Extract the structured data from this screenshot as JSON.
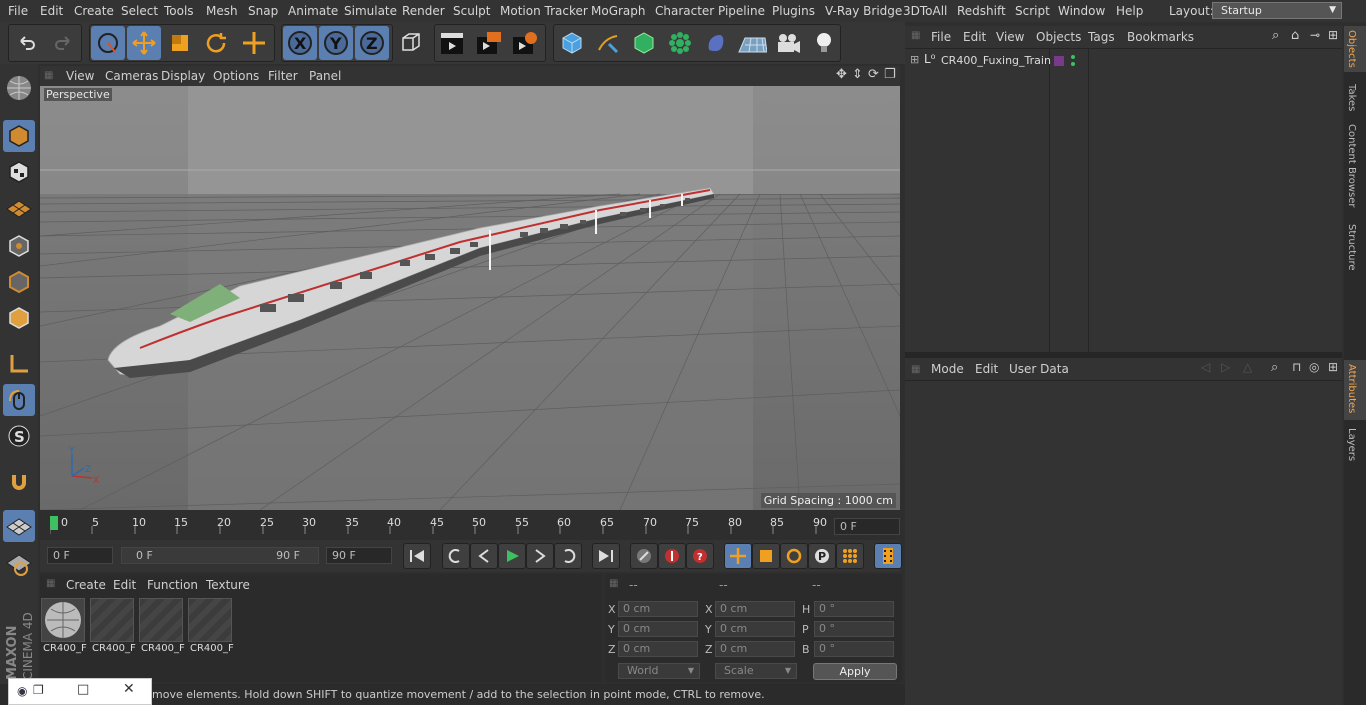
{
  "menubar": {
    "items": [
      "File",
      "Edit",
      "Create",
      "Select",
      "Tools",
      "Mesh",
      "Snap",
      "Animate",
      "Simulate",
      "Render",
      "Sculpt",
      "Motion Tracker",
      "MoGraph",
      "Character",
      "Pipeline",
      "Plugins",
      "V-Ray Bridge",
      "3DToAll",
      "Redshift",
      "Script",
      "Window",
      "Help"
    ],
    "layout_label": "Layout:",
    "layout_value": "Startup"
  },
  "viewport": {
    "menu": [
      "View",
      "Cameras",
      "Display",
      "Options",
      "Filter",
      "Panel"
    ],
    "camera_label": "Perspective",
    "grid_spacing": "Grid Spacing : 1000 cm"
  },
  "timeline": {
    "ticks": [
      "0",
      "5",
      "10",
      "15",
      "20",
      "25",
      "30",
      "35",
      "40",
      "45",
      "50",
      "55",
      "60",
      "65",
      "70",
      "75",
      "80",
      "85",
      "90"
    ],
    "current_frame": "0 F",
    "start_frame": "0 F",
    "range_start": "0 F",
    "range_end": "90 F",
    "end_frame": "90 F"
  },
  "materials": {
    "menu": [
      "Create",
      "Edit",
      "Function",
      "Texture"
    ],
    "items": [
      "CR400_F",
      "CR400_F",
      "CR400_F",
      "CR400_F"
    ]
  },
  "coords": {
    "headers": [
      "--",
      "--",
      "--"
    ],
    "rows": [
      {
        "a": "X",
        "av": "0 cm",
        "b": "X",
        "bv": "0 cm",
        "c": "H",
        "cv": "0 °"
      },
      {
        "a": "Y",
        "av": "0 cm",
        "b": "Y",
        "bv": "0 cm",
        "c": "P",
        "cv": "0 °"
      },
      {
        "a": "Z",
        "av": "0 cm",
        "b": "Z",
        "bv": "0 cm",
        "c": "B",
        "cv": "0 °"
      }
    ],
    "world": "World",
    "scale": "Scale",
    "apply": "Apply"
  },
  "status": "move elements. Hold down SHIFT to quantize movement / add to the selection in point mode, CTRL to remove.",
  "objects": {
    "menu": [
      "File",
      "Edit",
      "View",
      "Objects",
      "Tags",
      "Bookmarks"
    ],
    "item_name": "CR400_Fuxing_Train",
    "tag_color": "#7a3a8c"
  },
  "attributes": {
    "menu": [
      "Mode",
      "Edit",
      "User Data"
    ]
  },
  "right_tabs": {
    "top": [
      "Objects",
      "Takes",
      "Content Browser",
      "Structure"
    ],
    "bottom": [
      "Attributes",
      "Layers"
    ]
  },
  "brand": {
    "maxon": "MAXON",
    "product": "CINEMA 4D"
  },
  "colors": {
    "accent": "#5b7fb0",
    "viewport": "#8a8a8a",
    "highlight": "#f0a64c"
  }
}
